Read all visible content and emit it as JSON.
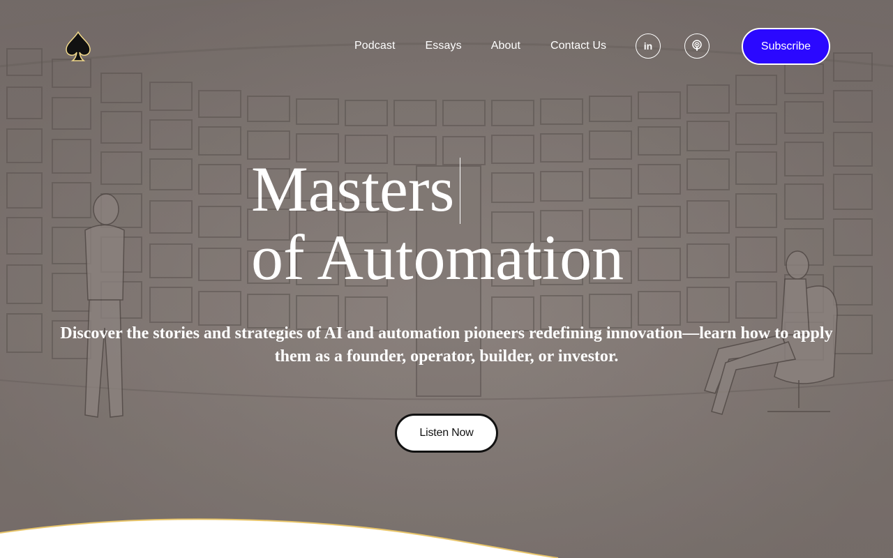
{
  "header": {
    "logo_icon": "spade-icon",
    "nav": [
      {
        "label": "Podcast"
      },
      {
        "label": "Essays"
      },
      {
        "label": "About"
      },
      {
        "label": "Contact Us"
      }
    ],
    "social": [
      {
        "icon": "linkedin-icon",
        "label": "in"
      },
      {
        "icon": "podcast-icon"
      }
    ],
    "subscribe_label": "Subscribe"
  },
  "hero": {
    "title_line1": "Masters",
    "title_line2": "of Automation",
    "subtitle": "Discover the stories and strategies of AI and automation pioneers redefining innovation—learn how to apply them as a founder, operator, builder, or investor.",
    "cta_label": "Listen Now"
  },
  "colors": {
    "subscribe_bg": "#2b08ff",
    "wave_stroke": "#e8c56a",
    "text": "#ffffff"
  }
}
